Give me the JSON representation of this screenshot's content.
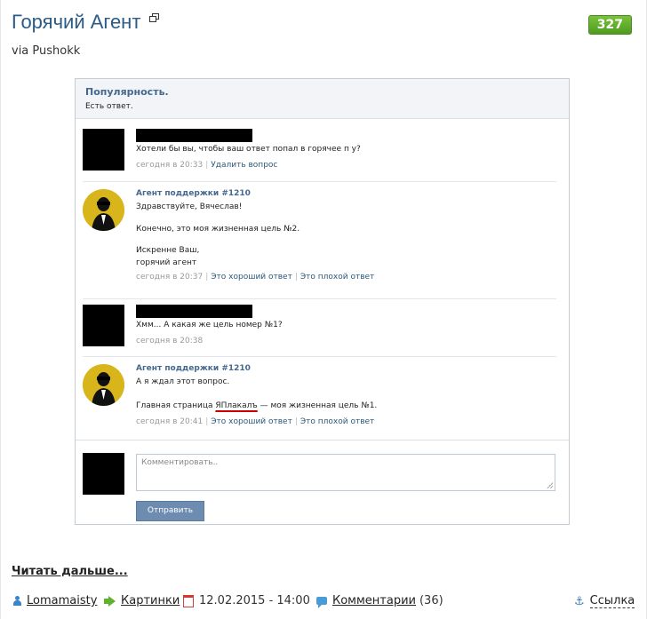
{
  "post": {
    "title": "Горячий Агент",
    "rating": "327",
    "via": "via Pushokk",
    "read_more": "Читать дальше...",
    "author": "Lomamaisty",
    "category": "Картинки",
    "date": "12.02.2015 - 14:00",
    "comments_label": "Комментарии",
    "comments_count": "(36)",
    "link_label": "Ссылка"
  },
  "screenshot": {
    "header_title": "Популярность.",
    "header_subtitle": "Есть ответ.",
    "messages": [
      {
        "author": "",
        "lines": [
          "Хотели бы вы, чтобы ваш ответ попал в горячее п        у?"
        ],
        "time": "сегодня в 20:33",
        "actions": [
          "Удалить вопрос"
        ]
      },
      {
        "author": "Агент поддержки #1210",
        "lines": [
          "Здравствуйте, Вячеслав!",
          "",
          "Конечно, это моя жизненная цель №2.",
          "",
          "Искренне Ваш,",
          "горячий агент"
        ],
        "time": "сегодня в 20:37",
        "actions": [
          "Это хороший ответ",
          "Это плохой ответ"
        ]
      },
      {
        "author": "",
        "lines": [
          "Хмм... А какая же цель номер №1?"
        ],
        "time": "сегодня в 20:38",
        "actions": []
      },
      {
        "author": "Агент поддержки #1210",
        "lines": [
          "А я ждал этот вопрос.",
          ""
        ],
        "line_last_pre": "Главная страница ",
        "line_last_underlined": "ЯПлакалъ",
        "line_last_post": " — моя жизненная цель №1.",
        "time": "сегодня в 20:41",
        "actions": [
          "Это хороший ответ",
          "Это плохой ответ"
        ]
      }
    ],
    "comment_placeholder": "Комментировать..",
    "send_button": "Отправить"
  },
  "colors": {
    "accent": "#45688e",
    "rating_green": "#5fa82a",
    "button_blue": "#6d8cb0"
  }
}
